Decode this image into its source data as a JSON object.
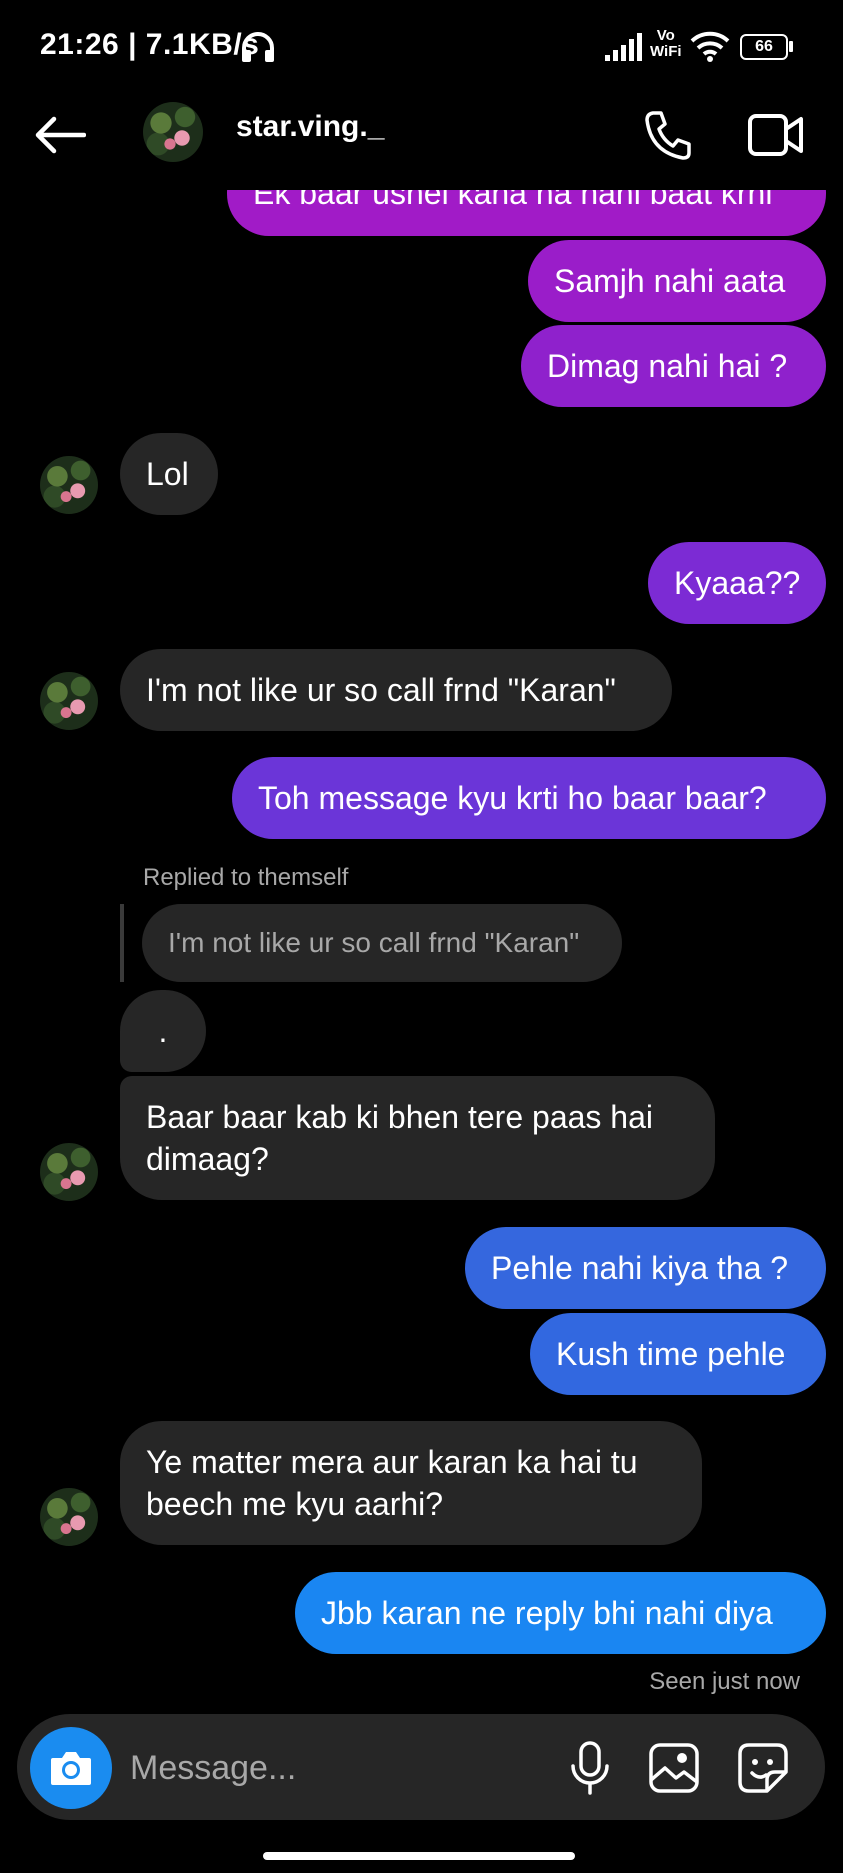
{
  "status_bar": {
    "time_speed": "21:26 | 7.1KB/s",
    "vowifi_top": "Vo",
    "vowifi_bottom": "WiFi",
    "battery": "66"
  },
  "header": {
    "contact_name": "star.ving._"
  },
  "messages": {
    "m0": "Ek baar ushei kaha na nahi baat krni",
    "m1": "Samjh nahi aata",
    "m2": "Dimag nahi hai ?",
    "m3": "Lol",
    "m4": "Kyaaa??",
    "m5": "I'm not like ur so call frnd \"Karan\"",
    "m6": "Toh message kyu krti ho baar baar?",
    "reply_label": "Replied to themself",
    "reply_quote": "I'm not like ur so call frnd \"Karan\"",
    "m7": ".",
    "m8": "Baar baar kab ki bhen tere paas hai dimaag?",
    "m9": "Pehle nahi kiya tha ?",
    "m10": "Kush time pehle",
    "m11": "Ye matter mera aur karan ka hai tu beech me kyu aarhi?",
    "m12": "Jbb karan ne reply bhi nahi diya",
    "seen": "Seen just now"
  },
  "composer": {
    "placeholder": "Message..."
  },
  "colors": {
    "bg": "#000000",
    "incoming": "#262626",
    "out_purple": "#9b1cc7",
    "out_violet": "#7b2ed6",
    "out_blue": "#2f6ae0",
    "out_brightblue": "#1a86f2",
    "camera": "#1a8cf0"
  },
  "icons": [
    "back-arrow-icon",
    "phone-icon",
    "video-call-icon",
    "camera-icon",
    "microphone-icon",
    "gallery-icon",
    "sticker-icon",
    "headphones-icon",
    "signal-icon",
    "wifi-icon",
    "battery-icon"
  ]
}
